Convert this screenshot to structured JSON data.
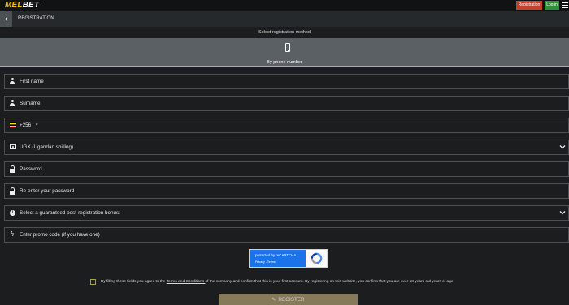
{
  "header": {
    "logo_main": "MEL",
    "logo_accent": "BET",
    "registration_button": "Registration",
    "login_button": "Log in"
  },
  "page": {
    "back_icon": "chevron-left-icon",
    "title": "REGISTRATION"
  },
  "method": {
    "label": "Select registration method",
    "option": "By phone number"
  },
  "form": {
    "first_name": "First name",
    "surname": "Surname",
    "phone_code": "+256",
    "currency": "UGX (Ugandan shilling)",
    "password": "Password",
    "reenter_password": "Re-enter your password",
    "bonus": "Select a guaranteed post-registration bonus:",
    "promo": "Enter promo code (if you have one)"
  },
  "recaptcha": {
    "line1": "protected by reCAPTCHA",
    "line2": "Privacy - Terms"
  },
  "agreement": {
    "before": "By filling these fields you agree to the ",
    "link": "Terms and Conditions ",
    "after": "of the company and confirm that this is your first account. By registering on this website, you confirm that you are over 18 years old years of age."
  },
  "register_button": "REGISTER",
  "colors": {
    "accent_yellow": "#e6b400",
    "registration_red": "#c4422b",
    "login_green": "#2f8f3a",
    "recaptcha_blue": "#1a73e8"
  }
}
